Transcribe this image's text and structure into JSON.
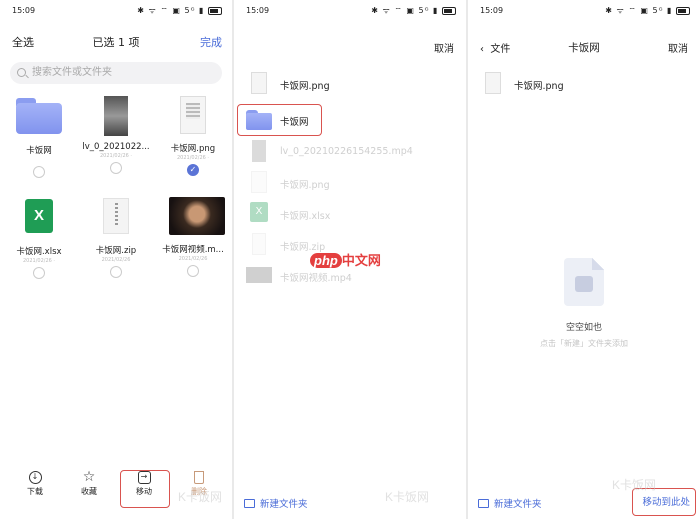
{
  "status": {
    "time": "15:09",
    "icons": "✱ ᯤ ⌔ ▣ 5ᴳ ▮",
    "battery": "battery"
  },
  "panel1": {
    "select_all": "全选",
    "header_title": "已选 1 项",
    "done": "完成",
    "search_placeholder": "搜索文件或文件夹",
    "tiles": [
      {
        "name": "卡饭网",
        "meta": "",
        "type": "folder",
        "checked": false
      },
      {
        "name": "lv_0_2021022...",
        "meta": "2021/02/26 ·",
        "type": "video",
        "checked": false
      },
      {
        "name": "卡饭网.png",
        "meta": "2021/02/26 ·",
        "type": "image",
        "checked": true
      },
      {
        "name": "卡饭网.xlsx",
        "meta": "2021/02/26 ·",
        "type": "xlsx",
        "checked": false
      },
      {
        "name": "卡饭网.zip",
        "meta": "2021/02/26",
        "type": "zip",
        "checked": false
      },
      {
        "name": "卡饭网视频.m...",
        "meta": "2021/02/26",
        "type": "movie",
        "checked": false
      }
    ],
    "actions": [
      {
        "label": "下载",
        "icon": "download-icon"
      },
      {
        "label": "收藏",
        "icon": "star-icon"
      },
      {
        "label": "移动",
        "icon": "move-icon"
      },
      {
        "label": "删除",
        "icon": "trash-icon"
      }
    ]
  },
  "panel2": {
    "cancel": "取消",
    "rows": [
      {
        "label": "卡饭网.png",
        "icon": "image-file-icon",
        "dim": false
      },
      {
        "label": "卡饭网",
        "icon": "folder-icon",
        "dim": false
      },
      {
        "label": "lv_0_20210226154255.mp4",
        "icon": "video-file-icon",
        "dim": true
      },
      {
        "label": "卡饭网.png",
        "icon": "image-file-icon",
        "dim": true
      },
      {
        "label": "卡饭网.xlsx",
        "icon": "xlsx-file-icon",
        "dim": true
      },
      {
        "label": "卡饭网.zip",
        "icon": "zip-file-icon",
        "dim": true
      },
      {
        "label": "卡饭网视频.mp4",
        "icon": "video-file-icon",
        "dim": true
      }
    ],
    "new_folder": "新建文件夹"
  },
  "panel3": {
    "back_label": "文件",
    "title": "卡饭网",
    "cancel": "取消",
    "file_label": "卡饭网.png",
    "empty_title": "空空如也",
    "empty_sub": "点击「新建」文件夹添加",
    "new_folder": "新建文件夹",
    "move_here": "移动到此处"
  },
  "watermarks": {
    "php_a": "php",
    "php_b": "中文网",
    "kafan": "K卡饭网"
  },
  "colors": {
    "accent": "#4a6cd8",
    "highlight": "#d9534f",
    "folder": "#8b9df0"
  }
}
